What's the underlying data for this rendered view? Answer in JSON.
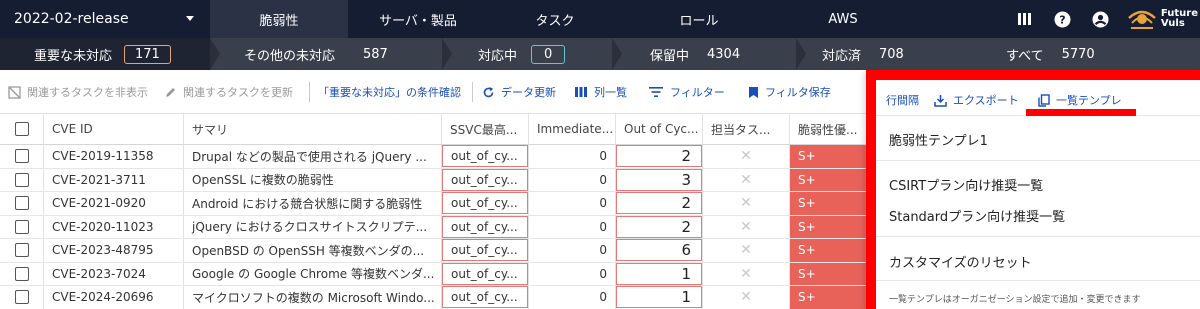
{
  "nav": {
    "release": "2022-02-release",
    "tabs": [
      "脆弱性",
      "サーバ・製品",
      "タスク",
      "ロール",
      "AWS"
    ],
    "logo_line1": "Future",
    "logo_line2": "Vuls"
  },
  "status": {
    "important_label": "重要な未対応",
    "important_count": "171",
    "other_label": "その他の未対応",
    "other_count": "587",
    "inprogress_label": "対応中",
    "inprogress_count": "0",
    "onhold_label": "保留中",
    "onhold_count": "4304",
    "done_label": "対応済",
    "done_count": "708",
    "all_label": "すべて",
    "all_count": "5770"
  },
  "toolbar": {
    "hide_tasks": "関連するタスクを非表示",
    "update_tasks": "関連するタスクを更新",
    "check_conditions": "「重要な未対応」の条件確認",
    "data_update": "データ更新",
    "columns": "列一覧",
    "filter": "フィルター",
    "save_filter": "フィルタ保存"
  },
  "table": {
    "headers": [
      "CVE ID",
      "サマリ",
      "SSVC最高...",
      "Immediate...",
      "Out of Cyc...",
      "担当タス...",
      "脆弱性優..."
    ],
    "rows": [
      {
        "cve": "CVE-2019-11358",
        "summary": "Drupal などの製品で使用される jQuery ...",
        "ssvc": "out_of_cy...",
        "immediate": "0",
        "ooc": "2",
        "sev": "S+"
      },
      {
        "cve": "CVE-2021-3711",
        "summary": "OpenSSL に複数の脆弱性",
        "ssvc": "out_of_cy...",
        "immediate": "0",
        "ooc": "3",
        "sev": "S+"
      },
      {
        "cve": "CVE-2021-0920",
        "summary": "Android における競合状態に関する脆弱性",
        "ssvc": "out_of_cy...",
        "immediate": "0",
        "ooc": "2",
        "sev": "S+"
      },
      {
        "cve": "CVE-2020-11023",
        "summary": "jQuery におけるクロスサイトスクリプテ...",
        "ssvc": "out_of_cy...",
        "immediate": "0",
        "ooc": "2",
        "sev": "S+"
      },
      {
        "cve": "CVE-2023-48795",
        "summary": "OpenBSD の OpenSSH 等複数ベンダの...",
        "ssvc": "out_of_cy...",
        "immediate": "0",
        "ooc": "6",
        "sev": "S+"
      },
      {
        "cve": "CVE-2023-7024",
        "summary": "Google の Google Chrome 等複数ベンダ...",
        "ssvc": "out_of_cy...",
        "immediate": "0",
        "ooc": "1",
        "sev": "S+"
      },
      {
        "cve": "CVE-2024-20696",
        "summary": "マイクロソフトの複数の Microsoft Windo...",
        "ssvc": "out_of_cy...",
        "immediate": "0",
        "ooc": "1",
        "sev": "S+"
      }
    ]
  },
  "menu": {
    "row_spacing": "行間隔",
    "export": "エクスポート",
    "template_list": "一覧テンプレ",
    "items": [
      "脆弱性テンプレ1",
      "CSIRTプラン向け推奨一覧",
      "Standardプラン向け推奨一覧",
      "カスタマイズのリセット"
    ],
    "footer": "一覧テンプレはオーガニゼーション設定で追加・変更できます"
  },
  "colors": {
    "nav_bg": "#151d33",
    "highlight": "#ff0000",
    "severity": "#e8625a",
    "link": "#1a4eb8"
  }
}
